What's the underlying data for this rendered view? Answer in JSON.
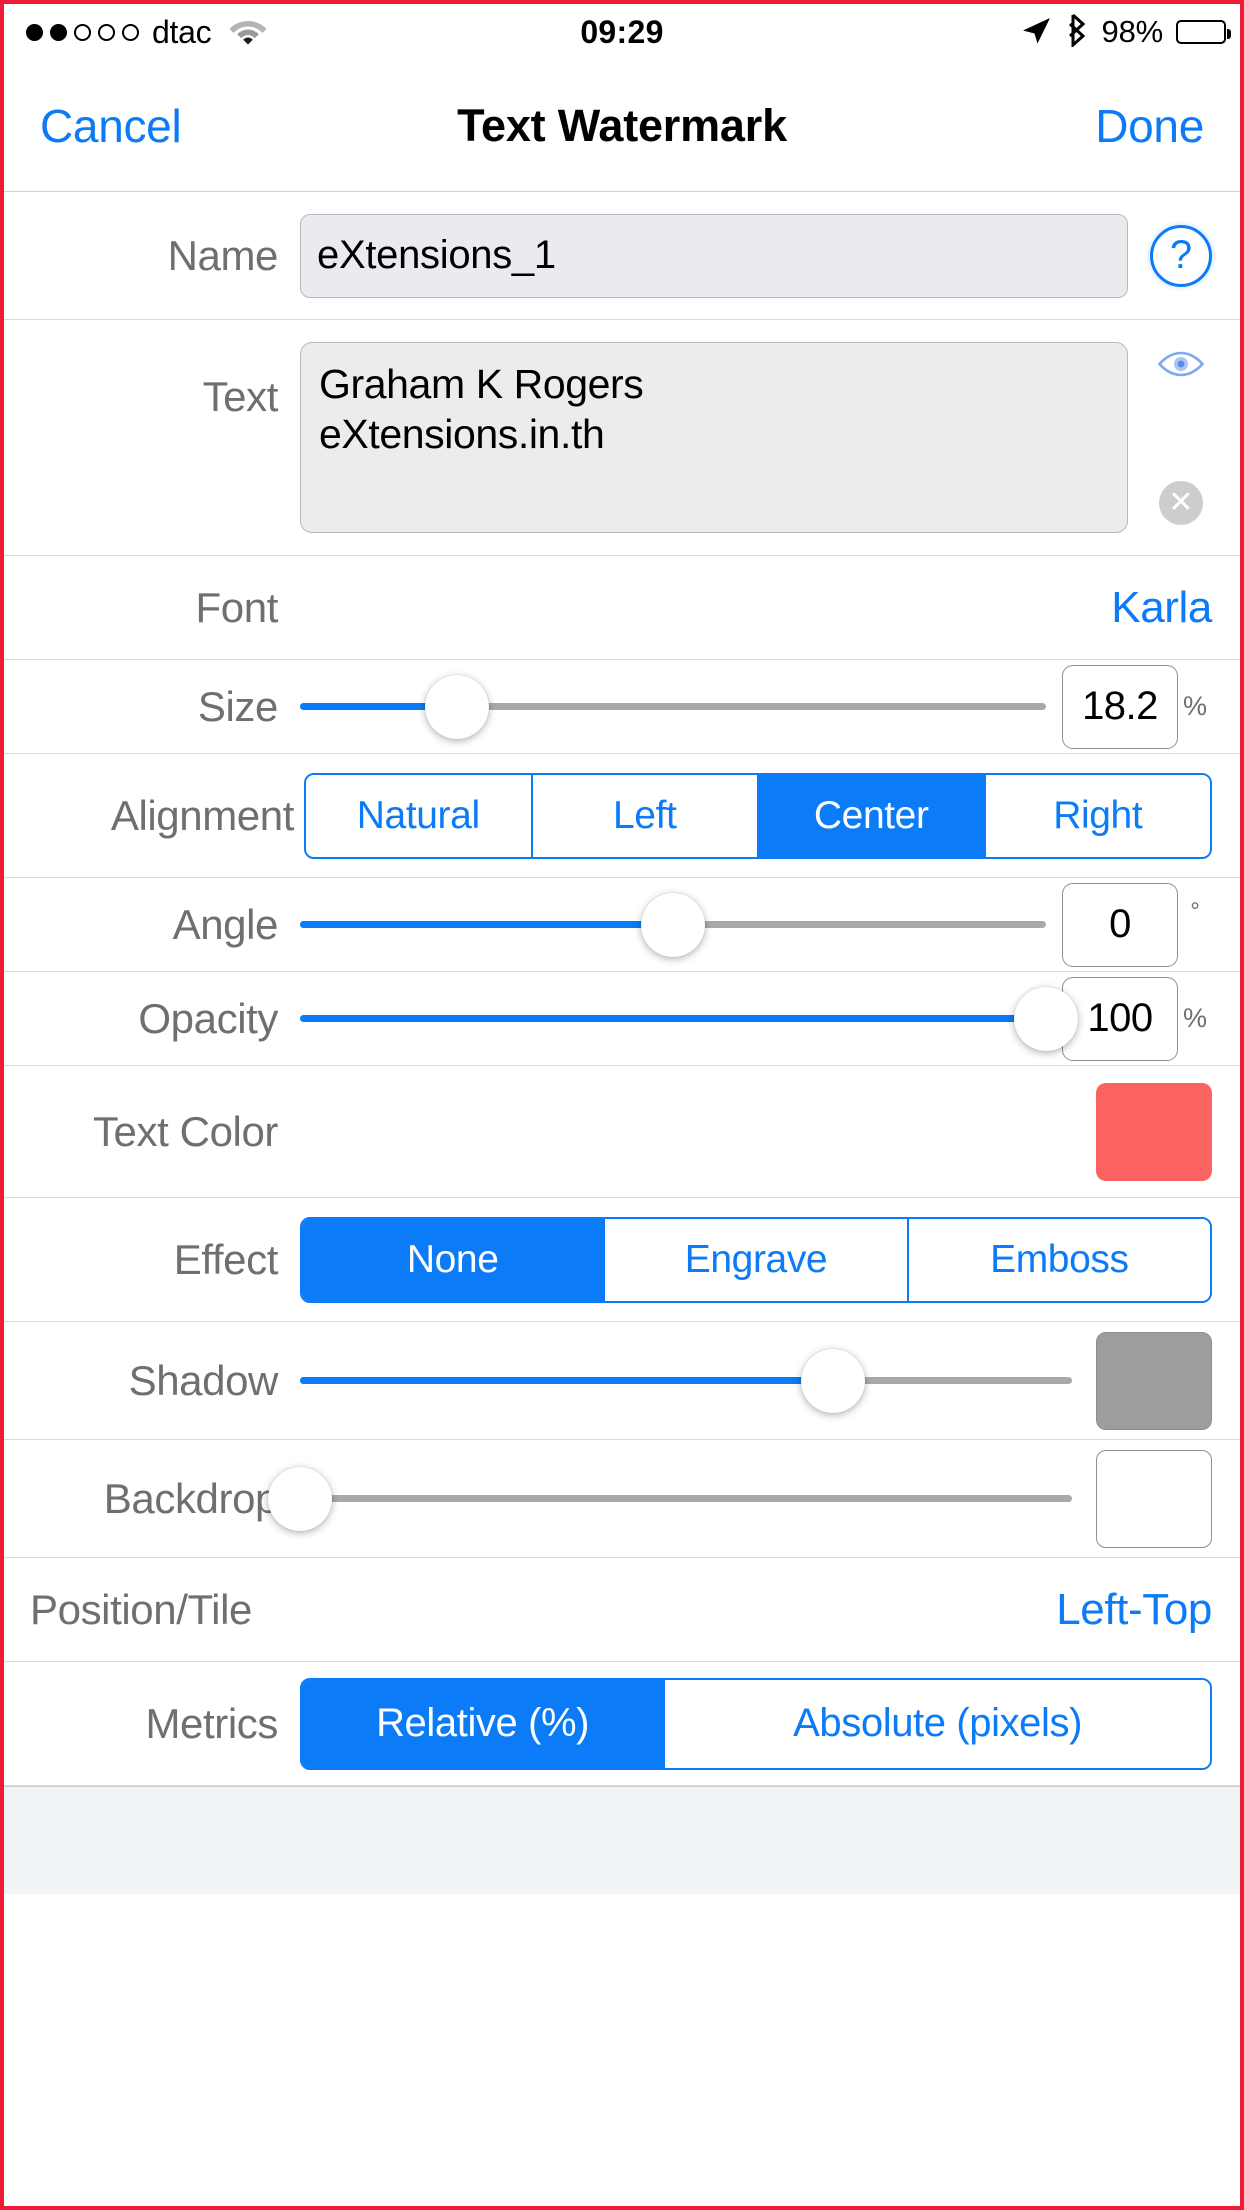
{
  "status_bar": {
    "signal_dots_filled": 2,
    "signal_dots_total": 5,
    "carrier": "dtac",
    "wifi_icon": "wifi-icon",
    "time": "09:29",
    "location_icon": "location-arrow-icon",
    "bluetooth_icon": "bluetooth-icon",
    "battery_percent": "98%",
    "battery_icon": "battery-full-icon"
  },
  "nav": {
    "cancel_label": "Cancel",
    "title": "Text Watermark",
    "done_label": "Done"
  },
  "form": {
    "name": {
      "label": "Name",
      "value": "eXtensions_1",
      "placeholder": "Name",
      "help_icon": "question-mark-circle-icon"
    },
    "text": {
      "label": "Text",
      "value": "Graham K Rogers\neXtensions.in.th",
      "placeholder": "Text",
      "preview_icon": "eye-icon",
      "clear_icon": "clear-circle-icon"
    },
    "font": {
      "label": "Font",
      "value": "Karla"
    },
    "size": {
      "label": "Size",
      "value": "18.2",
      "unit": "%",
      "percent": 21
    },
    "alignment": {
      "label": "Alignment",
      "options": [
        "Natural",
        "Left",
        "Center",
        "Right"
      ],
      "selected_index": 2
    },
    "angle": {
      "label": "Angle",
      "value": "0",
      "unit": "°",
      "percent": 50
    },
    "opacity": {
      "label": "Opacity",
      "value": "100",
      "unit": "%",
      "percent": 100
    },
    "text_color": {
      "label": "Text Color",
      "color": "#fb6262"
    },
    "effect": {
      "label": "Effect",
      "options": [
        "None",
        "Engrave",
        "Emboss"
      ],
      "selected_index": 0
    },
    "shadow": {
      "label": "Shadow",
      "percent": 69,
      "color": "#9d9d9d"
    },
    "backdrop": {
      "label": "Backdrop",
      "percent": 0,
      "color": "#ffffff"
    },
    "position_tile": {
      "label": "Position/Tile",
      "value": "Left-Top"
    },
    "metrics": {
      "label": "Metrics",
      "options": [
        "Relative (%)",
        "Absolute (pixels)"
      ],
      "selected_index": 0
    }
  },
  "theme": {
    "accent": "#0b7bf7",
    "label_gray": "#6e6e73",
    "separator": "#d9d9dc",
    "field_bg": "#ececec",
    "footer_bg": "#f0f4f7",
    "frame_border": "#ed1b34"
  }
}
